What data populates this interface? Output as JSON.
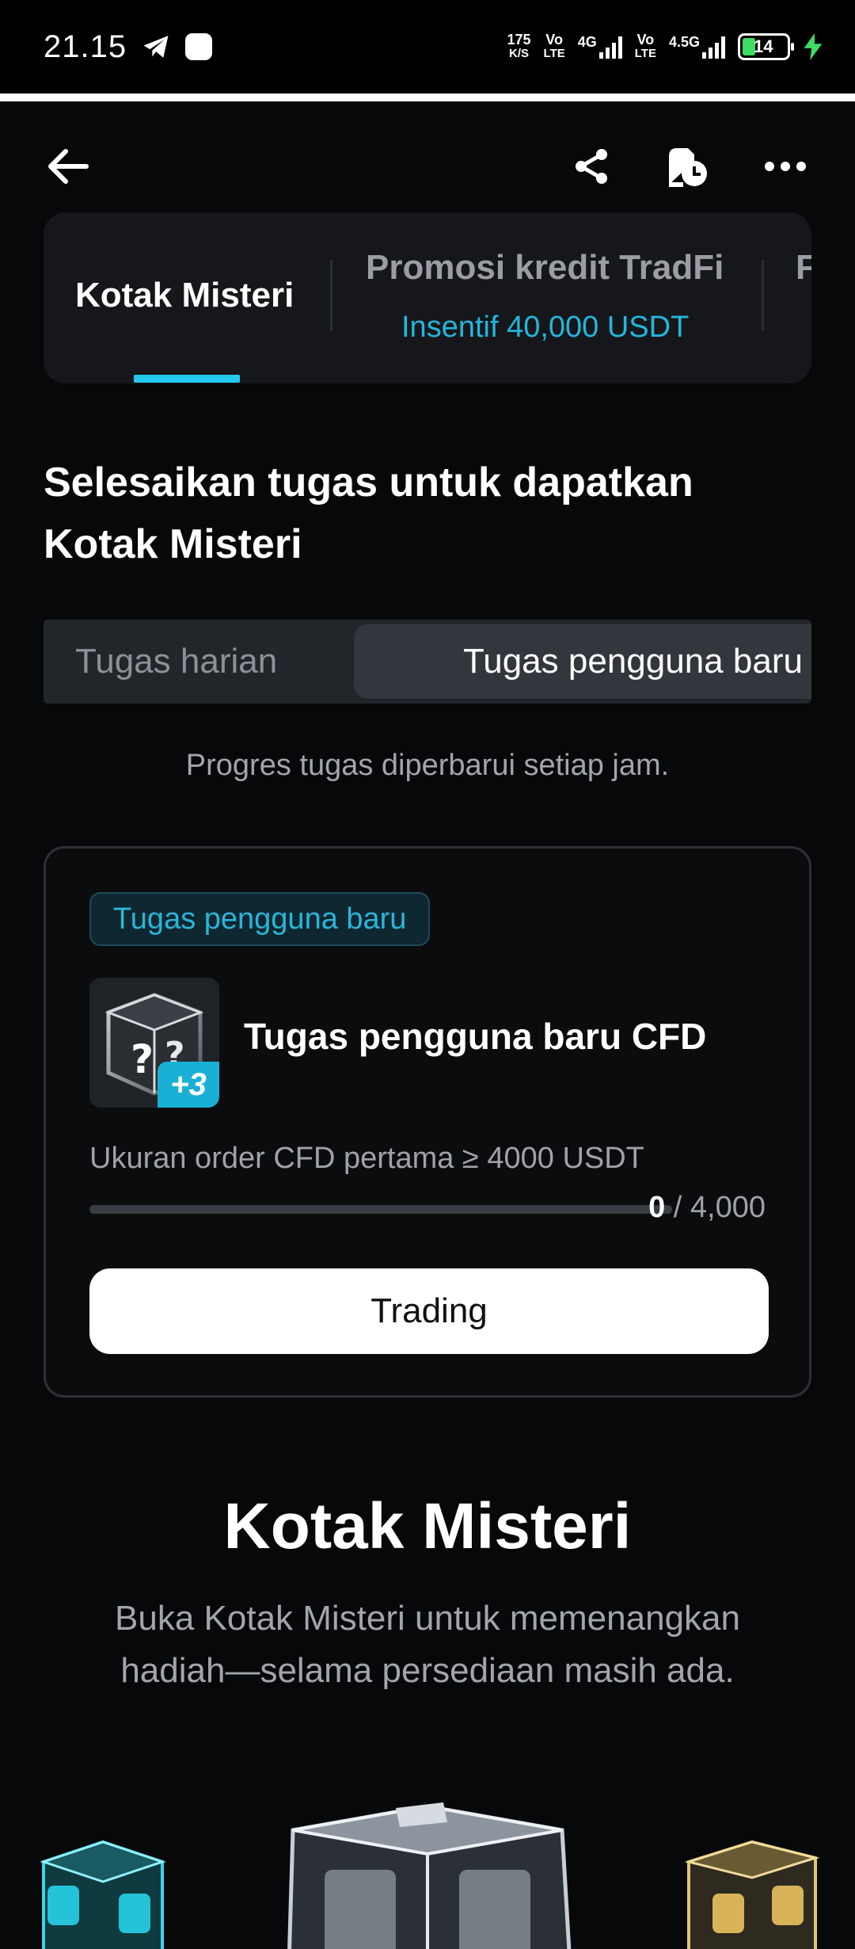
{
  "status_bar": {
    "time": "21.15",
    "net_speed_value": "175",
    "net_speed_unit": "K/S",
    "sim1_top": "Vo",
    "sim1_bottom": "LTE",
    "sim1_network": "4G",
    "sim2_top": "Vo",
    "sim2_bottom": "LTE",
    "sim2_network": "4.5G",
    "battery_level": "14",
    "icons": [
      "telegram-icon",
      "app-notification-icon",
      "signal-icon",
      "battery-icon",
      "charging-icon"
    ]
  },
  "nav": {
    "icons": [
      "back-arrow-icon",
      "share-icon",
      "history-icon",
      "more-icon"
    ]
  },
  "tabs": {
    "tab1": "Kotak Misteri",
    "tab2_title": "Promosi kredit TradFi",
    "tab2_subtitle": "Insentif 40,000 USDT",
    "tab3_partial": "F"
  },
  "heading": "Selesaikan tugas untuk dapatkan Kotak Misteri",
  "segment": {
    "option1": "Tugas harian",
    "option2": "Tugas pengguna baru",
    "selected": "Tugas pengguna baru"
  },
  "note": "Progres tugas diperbarui setiap jam.",
  "task": {
    "badge": "Tugas pengguna baru",
    "box_bonus": "+3",
    "title": "Tugas pengguna baru CFD",
    "description": "Ukuran order CFD pertama ≥ 4000 USDT",
    "progress_current": "0",
    "progress_target": "/ 4,000",
    "progress_fraction": 0,
    "button": "Trading"
  },
  "section": {
    "title": "Kotak Misteri",
    "subtitle": "Buka Kotak Misteri untuk memenangkan hadiah—selama persediaan masih ada."
  },
  "colors": {
    "background": "#070809",
    "accent": "#24c8ee",
    "card": "#15171a"
  }
}
